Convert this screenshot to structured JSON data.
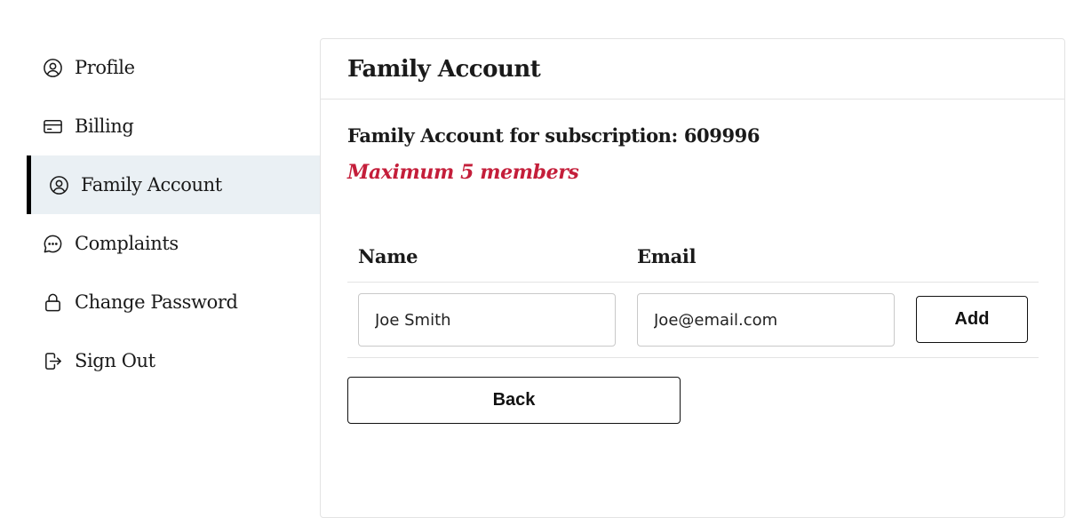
{
  "sidebar": {
    "items": [
      {
        "label": "Profile",
        "icon": "user-circle-icon"
      },
      {
        "label": "Billing",
        "icon": "credit-card-icon"
      },
      {
        "label": "Family Account",
        "icon": "user-circle-icon",
        "active": true
      },
      {
        "label": "Complaints",
        "icon": "chat-bubble-icon"
      },
      {
        "label": "Change Password",
        "icon": "lock-icon"
      },
      {
        "label": "Sign Out",
        "icon": "sign-out-icon"
      }
    ]
  },
  "main": {
    "title": "Family Account",
    "subscription_text": "Family Account for subscription: 609996",
    "max_members_note": "Maximum 5 members",
    "table": {
      "columns": [
        "Name",
        "Email"
      ],
      "new_member": {
        "name_value": "Joe Smith",
        "email_value": "Joe@email.com"
      },
      "add_label": "Add"
    },
    "back_label": "Back"
  },
  "colors": {
    "accent_red": "#c41e3a",
    "active_bg": "#eaf0f4",
    "active_bar": "#000000"
  }
}
